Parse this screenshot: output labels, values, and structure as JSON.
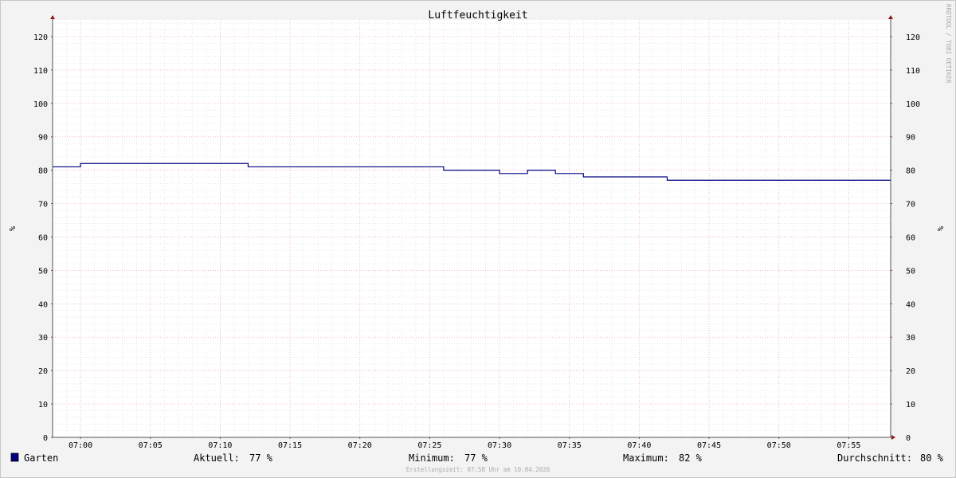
{
  "chart_data": {
    "type": "line",
    "title": "Luftfeuchtigkeit",
    "ylabel": "%",
    "y_ticks": [
      0,
      10,
      20,
      30,
      40,
      50,
      60,
      70,
      80,
      90,
      100,
      110,
      120
    ],
    "ylim": [
      0,
      125
    ],
    "xlim": [
      "06:58",
      "07:58"
    ],
    "x_ticks": [
      "07:00",
      "07:05",
      "07:10",
      "07:15",
      "07:20",
      "07:25",
      "07:30",
      "07:35",
      "07:40",
      "07:45",
      "07:50",
      "07:55"
    ],
    "grid": true,
    "series": [
      {
        "name": "Garten",
        "color": "#000080",
        "step": true,
        "x": [
          "06:58",
          "07:00",
          "07:12",
          "07:26",
          "07:30",
          "07:32",
          "07:34",
          "07:36",
          "07:42",
          "07:58"
        ],
        "y": [
          81,
          82,
          81,
          80,
          79,
          80,
          79,
          78,
          77,
          77
        ]
      }
    ]
  },
  "legend": {
    "series_name": "Garten",
    "series_color": "#000080",
    "stats": [
      {
        "label": "Aktuell:",
        "value": "77 %"
      },
      {
        "label": "Minimum:",
        "value": "77 %"
      },
      {
        "label": "Maximum:",
        "value": "82 %"
      },
      {
        "label": "Durchschnitt:",
        "value": "80 %"
      }
    ]
  },
  "footer": "Erstellungszeit: 07:58 Uhr am 10.04.2026",
  "watermark": "RRDTOOL / TOBI OETIKER"
}
